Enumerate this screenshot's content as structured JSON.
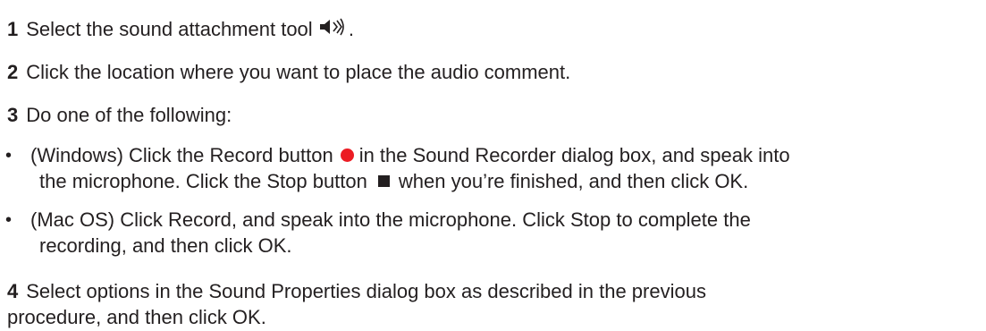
{
  "steps": {
    "s1": {
      "num": "1",
      "text_a": "Select the sound attachment tool",
      "text_b": ".",
      "icon": "speaker-icon"
    },
    "s2": {
      "num": "2",
      "text": "Click the location where you want to place the audio comment."
    },
    "s3": {
      "num": "3",
      "text": "Do one of the following:"
    },
    "b1": {
      "bullet": "•",
      "l1_a": "(Windows) Click the Record button",
      "l1_b": "in the Sound Recorder dialog box, and speak into",
      "l2_a": "the microphone. Click the Stop button",
      "l2_b": "when you’re finished, and then click OK.",
      "record_icon": "record-dot-icon",
      "stop_icon": "stop-square-icon",
      "record_color": "#ec1c24"
    },
    "b2": {
      "bullet": "•",
      "l1": "(Mac OS) Click Record, and speak into the microphone. Click Stop to complete the",
      "l2": "recording, and then click OK."
    },
    "s4": {
      "num": "4",
      "l1": "Select options in the Sound Properties dialog box as described in the previous",
      "l2": "procedure, and then click OK."
    }
  }
}
